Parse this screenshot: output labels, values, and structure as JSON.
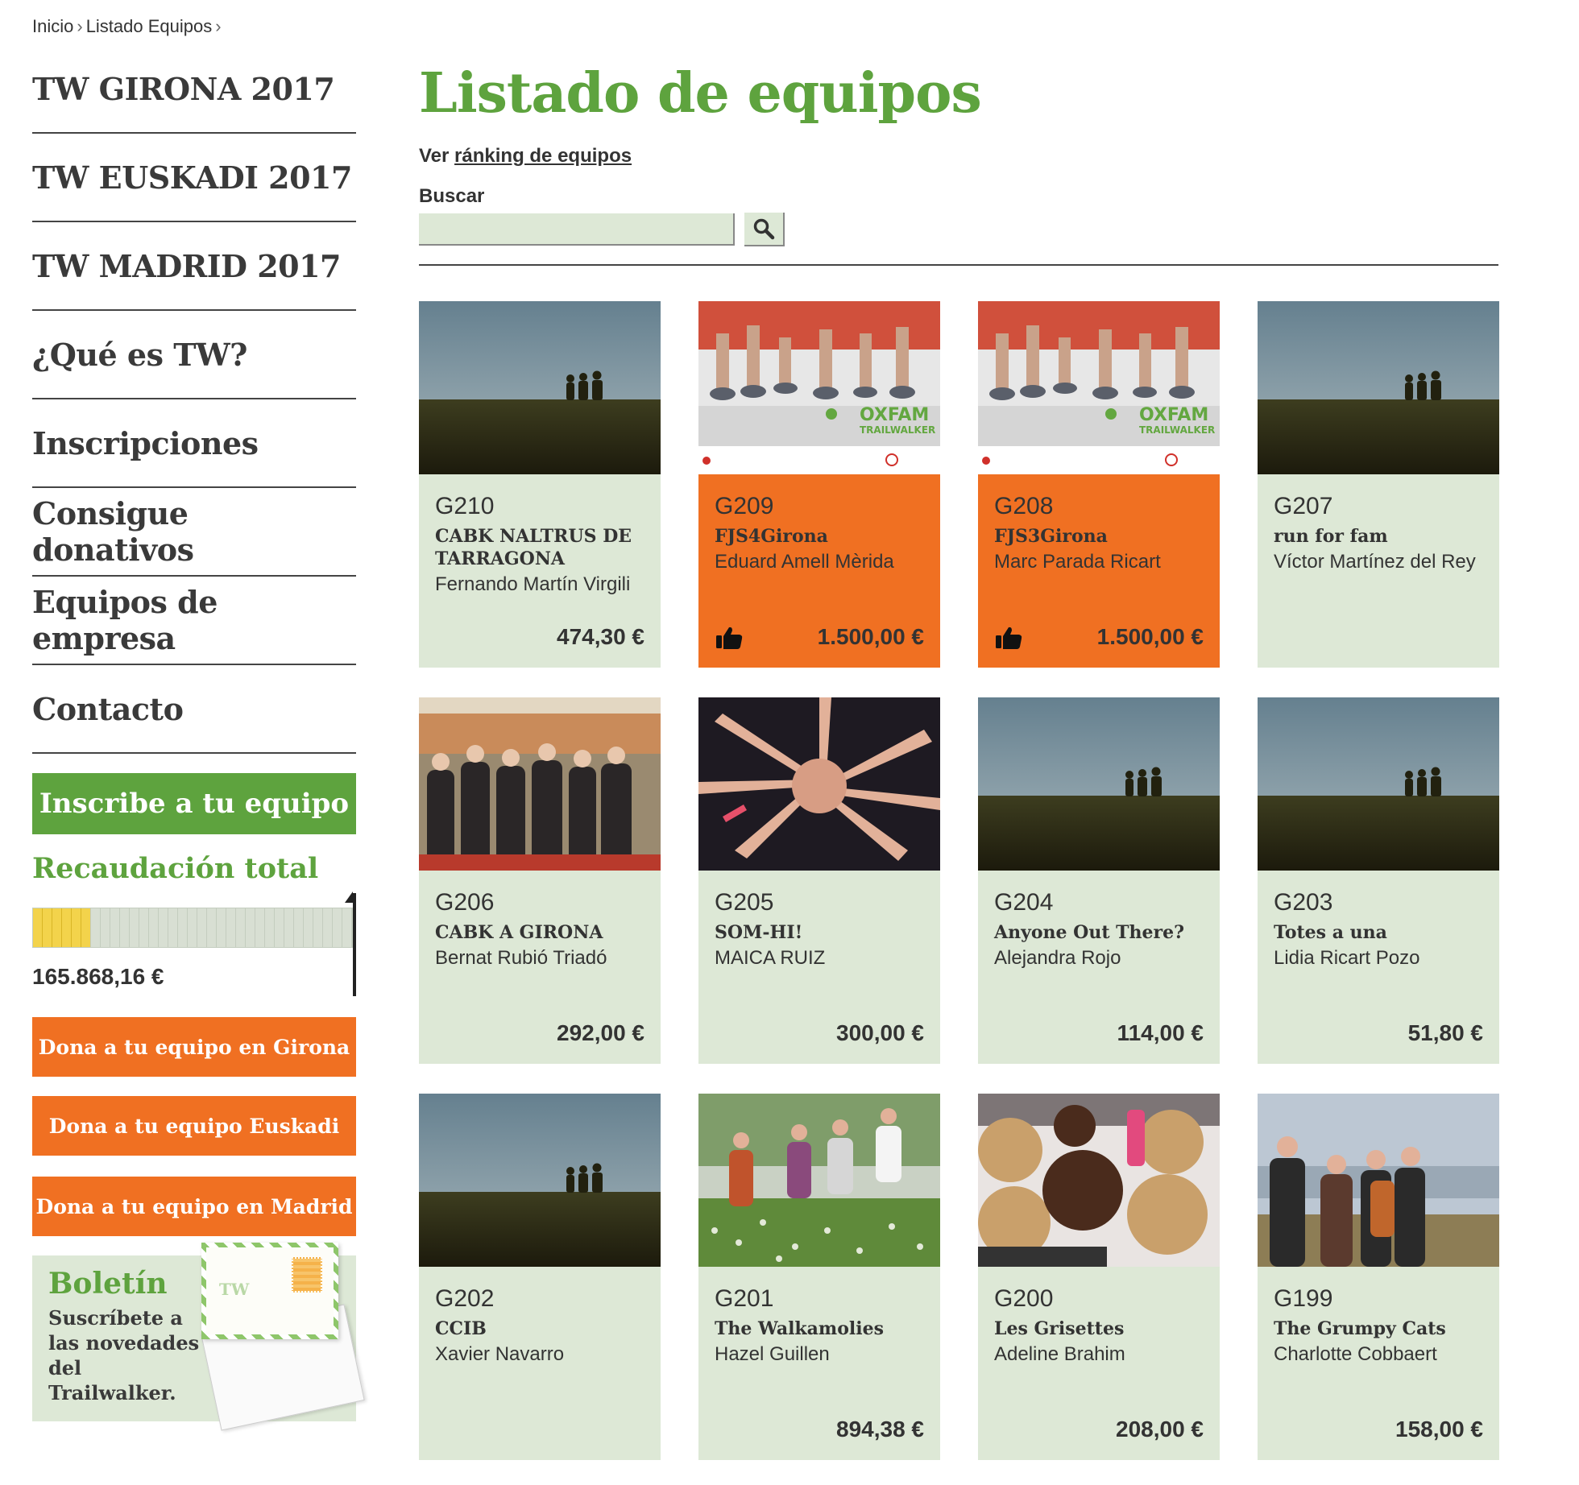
{
  "breadcrumb": {
    "home": "Inicio",
    "current": "Listado Equipos",
    "sep": "›"
  },
  "sidebar": {
    "nav": [
      {
        "label": "TW GIRONA 2017"
      },
      {
        "label": "TW EUSKADI 2017"
      },
      {
        "label": "TW MADRID 2017"
      },
      {
        "label": "¿Qué es TW?"
      },
      {
        "label": "Inscripciones"
      },
      {
        "label": "Consigue donativos"
      },
      {
        "label": "Equipos de empresa"
      },
      {
        "label": "Contacto"
      }
    ],
    "inscribe_label": "Inscribe a tu equipo",
    "recaudacion": {
      "title": "Recaudación total",
      "amount": "165.868,16 €",
      "progress_fraction": 0.18
    },
    "dona_buttons": [
      {
        "label": "Dona a tu equipo en Girona"
      },
      {
        "label": "Dona a tu equipo Euskadi"
      },
      {
        "label": "Dona a tu equipo en Madrid"
      }
    ],
    "boletin": {
      "title": "Boletín",
      "text": "Suscríbete a las novedades del Trailwalker.",
      "envelope_mark": "TW"
    }
  },
  "main": {
    "title": "Listado de equipos",
    "ranking_prefix": "Ver",
    "ranking_link": "ránking de equipos",
    "search_label": "Buscar",
    "search_value": "",
    "colors": {
      "green": "#5ea33e",
      "orange": "#f07022",
      "card_bg": "#dde8d6"
    }
  },
  "teams": [
    {
      "code": "G210",
      "name": "CABK NALTRUS DE TARRAGONA",
      "captain": "Fernando Martín Virgili",
      "amount": "474,30 €",
      "highlight": false,
      "image": "default-silhouette"
    },
    {
      "code": "G209",
      "name": "FJS4Girona",
      "captain": "Eduard Amell Mèrida",
      "amount": "1.500,00 €",
      "highlight": true,
      "image": "oxfam-trailwalker-runners"
    },
    {
      "code": "G208",
      "name": "FJS3Girona",
      "captain": "Marc Parada Ricart",
      "amount": "1.500,00 €",
      "highlight": true,
      "image": "oxfam-trailwalker-runners"
    },
    {
      "code": "G207",
      "name": "run for fam",
      "captain": "Víctor Martínez del Rey",
      "amount": "",
      "highlight": false,
      "image": "default-silhouette"
    },
    {
      "code": "G206",
      "name": "CABK A GIRONA",
      "captain": "Bernat Rubió Triadó",
      "amount": "292,00 €",
      "highlight": false,
      "image": "group-photo-city"
    },
    {
      "code": "G205",
      "name": "SOM-HI!",
      "captain": "MAICA RUIZ",
      "amount": "300,00 €",
      "highlight": false,
      "image": "hands-together"
    },
    {
      "code": "G204",
      "name": "Anyone Out There?",
      "captain": "Alejandra Rojo",
      "amount": "114,00 €",
      "highlight": false,
      "image": "default-silhouette"
    },
    {
      "code": "G203",
      "name": "Totes a una",
      "captain": "Lidia Ricart Pozo",
      "amount": "51,80 €",
      "highlight": false,
      "image": "default-silhouette"
    },
    {
      "code": "G202",
      "name": "CCIB",
      "captain": "Xavier Navarro",
      "amount": "",
      "highlight": false,
      "image": "default-silhouette"
    },
    {
      "code": "G201",
      "name": "The Walkamolies",
      "captain": "Hazel Guillen",
      "amount": "894,38 €",
      "highlight": false,
      "image": "women-jumping-field"
    },
    {
      "code": "G200",
      "name": "Les Grisettes",
      "captain": "Adeline Brahim",
      "amount": "208,00 €",
      "highlight": false,
      "image": "cakes-table"
    },
    {
      "code": "G199",
      "name": "The Grumpy Cats",
      "captain": "Charlotte Cobbaert",
      "amount": "158,00 €",
      "highlight": false,
      "image": "group-hill-view"
    }
  ],
  "thumb_texts": {
    "oxfam": "OXFAM",
    "trailwalker": "TRAILWALKER"
  }
}
